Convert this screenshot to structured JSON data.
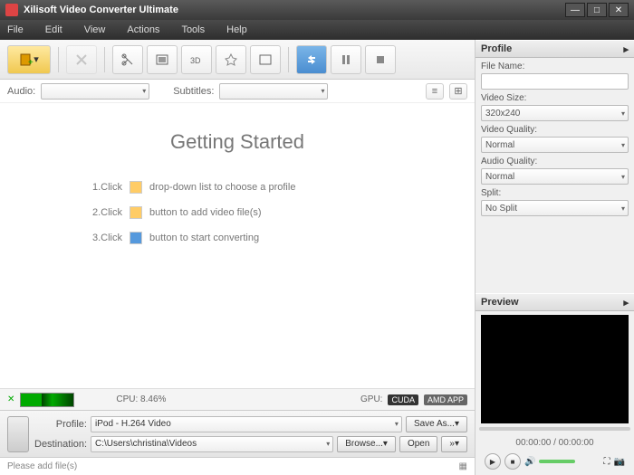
{
  "window": {
    "title": "Xilisoft Video Converter Ultimate"
  },
  "menubar": [
    "File",
    "Edit",
    "View",
    "Actions",
    "Tools",
    "Help"
  ],
  "filter": {
    "audio_label": "Audio:",
    "subtitles_label": "Subtitles:"
  },
  "getting_started": {
    "title": "Getting Started",
    "steps": [
      {
        "n": "1.Click",
        "text": "drop-down list to choose a profile"
      },
      {
        "n": "2.Click",
        "text": "button to add video file(s)"
      },
      {
        "n": "3.Click",
        "text": "button to start converting"
      }
    ]
  },
  "cpu": {
    "label": "CPU: 8.46%",
    "gpu_label": "GPU:",
    "cuda": "CUDA",
    "amd": "AMD APP"
  },
  "profile": {
    "profile_label": "Profile:",
    "profile_value": "iPod - H.264 Video",
    "dest_label": "Destination:",
    "dest_value": "C:\\Users\\christina\\Videos",
    "saveas": "Save As...",
    "browse": "Browse...",
    "open": "Open"
  },
  "status": {
    "msg": "Please add file(s)"
  },
  "side": {
    "profile_head": "Profile",
    "filename_label": "File Name:",
    "filename_value": "",
    "videosize_label": "Video Size:",
    "videosize_value": "320x240",
    "videoquality_label": "Video Quality:",
    "videoquality_value": "Normal",
    "audioquality_label": "Audio Quality:",
    "audioquality_value": "Normal",
    "split_label": "Split:",
    "split_value": "No Split",
    "preview_head": "Preview",
    "time": "00:00:00 / 00:00:00"
  }
}
